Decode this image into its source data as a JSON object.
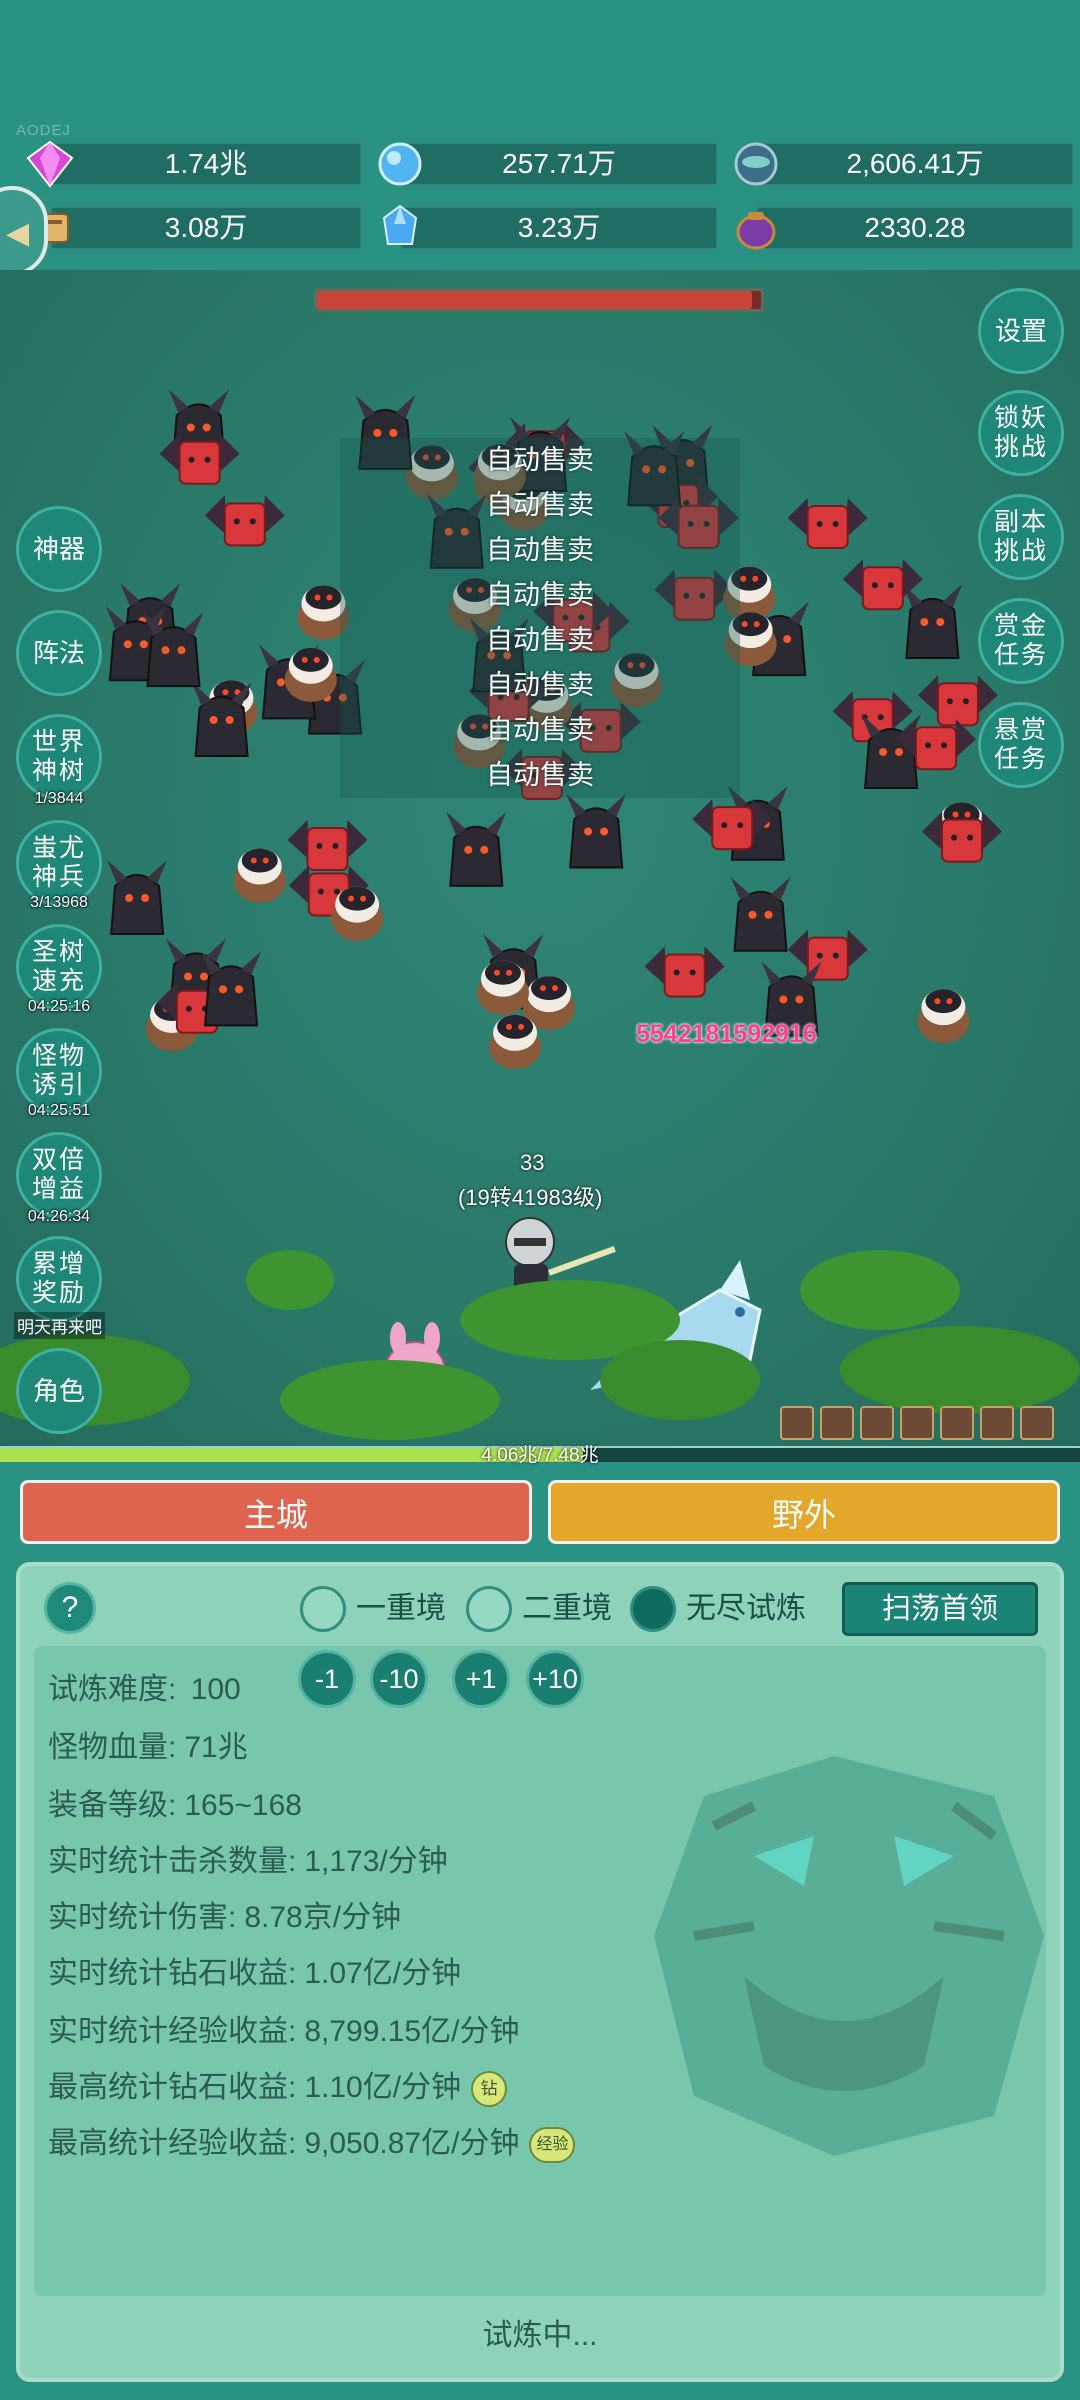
{
  "corner_tag": "AODEJ",
  "resources": [
    {
      "icon": "diamond-icon",
      "value": "1.74兆"
    },
    {
      "icon": "blue-orb-icon",
      "value": "257.71万"
    },
    {
      "icon": "teal-orb-icon",
      "value": "2,606.41万"
    },
    {
      "icon": "scroll-icon",
      "value": "3.08万"
    },
    {
      "icon": "crystal-icon",
      "value": "3.23万"
    },
    {
      "icon": "purple-pouch-icon",
      "value": "2330.28"
    }
  ],
  "boss_hp_fraction": 0.98,
  "right_menu": [
    "设置",
    "锁妖\n挑战",
    "副本\n挑战",
    "赏金\n任务",
    "悬赏\n任务"
  ],
  "left_menu": [
    {
      "label": "神器",
      "sub": ""
    },
    {
      "label": "阵法",
      "sub": ""
    },
    {
      "label": "世界\n神树",
      "sub": "1/3844"
    },
    {
      "label": "蚩尤\n神兵",
      "sub": "3/13968"
    },
    {
      "label": "圣树\n速充",
      "sub": "04:25:16"
    },
    {
      "label": "怪物\n诱引",
      "sub": "04:25:51"
    },
    {
      "label": "双倍\n增益",
      "sub": "04:26:34"
    },
    {
      "label": "累增\n奖励",
      "sub": ""
    }
  ],
  "role_button": "角色",
  "tomorrow_text": "明天再来吧",
  "auto_sell": [
    "自动售卖",
    "自动售卖",
    "自动售卖",
    "自动售卖",
    "自动售卖",
    "自动售卖",
    "自动售卖",
    "自动售卖"
  ],
  "damage_number": "5542181592916",
  "player_number": "33",
  "player_level": "(19转41983级)",
  "exp_text": "4.06兆/7.48兆",
  "exp_fraction": 0.54,
  "tabs": {
    "main": "主城",
    "wild": "野外"
  },
  "panel": {
    "help": "?",
    "modes": [
      {
        "label": "一重境",
        "selected": false
      },
      {
        "label": "二重境",
        "selected": false
      },
      {
        "label": "无尽试炼",
        "selected": true
      }
    ],
    "sweep_button": "扫荡首领",
    "difficulty_label": "试炼难度:",
    "difficulty_value": "100",
    "steps": [
      "-1",
      "-10",
      "+1",
      "+10"
    ],
    "stats": [
      {
        "label": "怪物血量:",
        "value": "71兆"
      },
      {
        "label": "装备等级:",
        "value": "165~168"
      },
      {
        "label": "实时统计击杀数量:",
        "value": "1,173/分钟"
      },
      {
        "label": "实时统计伤害:",
        "value": "8.78京/分钟"
      },
      {
        "label": "实时统计钻石收益:",
        "value": "1.07亿/分钟"
      },
      {
        "label": "实时统计经验收益:",
        "value": "8,799.15亿/分钟"
      },
      {
        "label": "最高统计钻石收益:",
        "value": "1.10亿/分钟"
      },
      {
        "label": "最高统计经验收益:",
        "value": "9,050.87亿/分钟"
      }
    ],
    "badge_diamond": "钻",
    "badge_exp": "经验",
    "status": "试炼中..."
  }
}
